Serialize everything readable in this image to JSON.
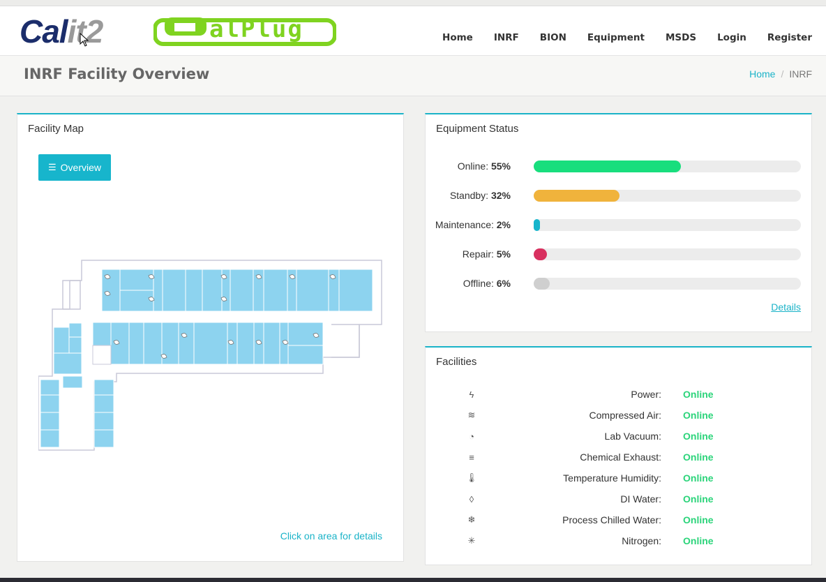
{
  "header": {
    "logo_left_a": "Cal",
    "logo_left_b": "it2",
    "logo_right": "CalPlug",
    "nav": [
      "Home",
      "INRF",
      "BION",
      "Equipment",
      "MSDS",
      "Login",
      "Register"
    ]
  },
  "titlebar": {
    "title": "INRF Facility Overview",
    "breadcrumb": [
      "Home",
      "INRF"
    ]
  },
  "map_panel": {
    "title": "Facility Map",
    "button_label": "Overview",
    "hint": "Click on area for details"
  },
  "equipment_panel": {
    "title": "Equipment Status",
    "rows": [
      {
        "label": "Online:",
        "value": "55%",
        "fraction": 0.55,
        "color": "#18de7d"
      },
      {
        "label": "Standby:",
        "value": "32%",
        "fraction": 0.32,
        "color": "#f0b33c"
      },
      {
        "label": "Maintenance:",
        "value": "2%",
        "fraction": 0.02,
        "color": "#17b5cc"
      },
      {
        "label": "Repair:",
        "value": "5%",
        "fraction": 0.05,
        "color": "#d8305f"
      },
      {
        "label": "Offline:",
        "value": "6%",
        "fraction": 0.06,
        "color": "#cfcfcf"
      }
    ],
    "details": "Details"
  },
  "facilities_panel": {
    "title": "Facilities",
    "rows": [
      {
        "icon": "lightning-icon",
        "glyph": "ϟ",
        "label": "Power:",
        "status": "Online"
      },
      {
        "icon": "wind-icon",
        "glyph": "≋",
        "label": "Compressed Air:",
        "status": "Online"
      },
      {
        "icon": "gauge-icon",
        "glyph": "◔",
        "label": "Lab Vacuum:",
        "status": "Online"
      },
      {
        "icon": "exhaust-icon",
        "glyph": "≡",
        "label": "Chemical Exhaust:",
        "status": "Online"
      },
      {
        "icon": "thermometer-icon",
        "glyph": "🌡",
        "label": "Temperature Humidity:",
        "status": "Online"
      },
      {
        "icon": "droplet-icon",
        "glyph": "◊",
        "label": "DI Water:",
        "status": "Online"
      },
      {
        "icon": "snowflake-icon",
        "glyph": "❄",
        "label": "Process Chilled Water:",
        "status": "Online"
      },
      {
        "icon": "asterisk-icon",
        "glyph": "✳",
        "label": "Nitrogen:",
        "status": "Online"
      }
    ]
  },
  "colors": {
    "accent": "#1ab3c8",
    "online": "#2bd47a",
    "room": "#8dd3ef"
  }
}
